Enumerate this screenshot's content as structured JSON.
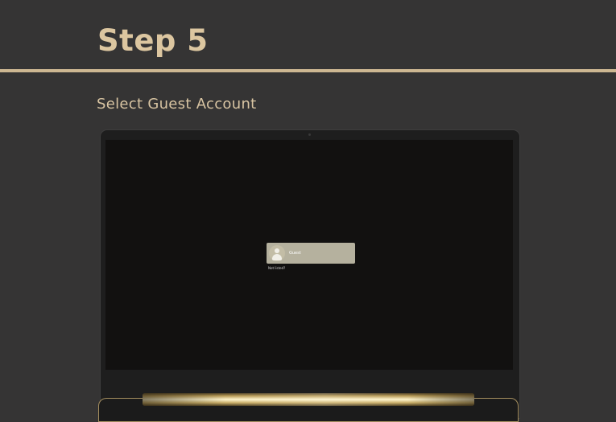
{
  "header": {
    "step_title": "Step 5"
  },
  "instruction": {
    "text": "Select Guest Account"
  },
  "login_screen": {
    "account_name": "Guest",
    "not_listed_link": "Not listed?"
  },
  "colors": {
    "background": "#353434",
    "accent_gold": "#cdb792",
    "screen": "#121110",
    "account_tile": "#b5b19e"
  },
  "icons": {
    "avatar": "user-silhouette-icon"
  }
}
